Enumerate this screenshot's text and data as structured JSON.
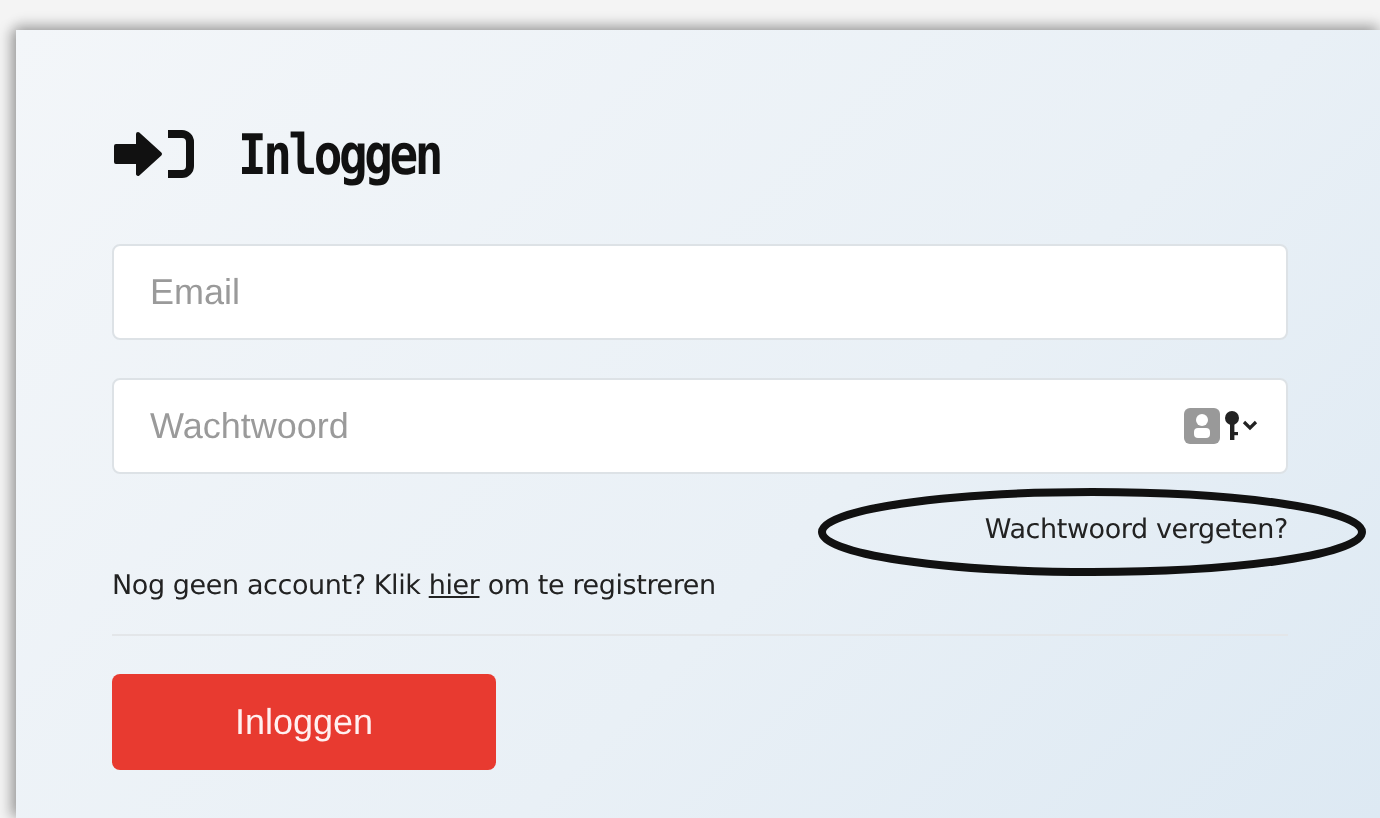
{
  "title": "Inloggen",
  "fields": [
    {
      "kind": "email",
      "placeholder": "Email"
    },
    {
      "kind": "password",
      "placeholder": "Wachtwoord"
    }
  ],
  "forgot_link": "Wachtwoord vergeten?",
  "register": {
    "before": "Nog geen account? Klik ",
    "link": "hier",
    "after": " om te registreren"
  },
  "submit_button": "Inloggen"
}
